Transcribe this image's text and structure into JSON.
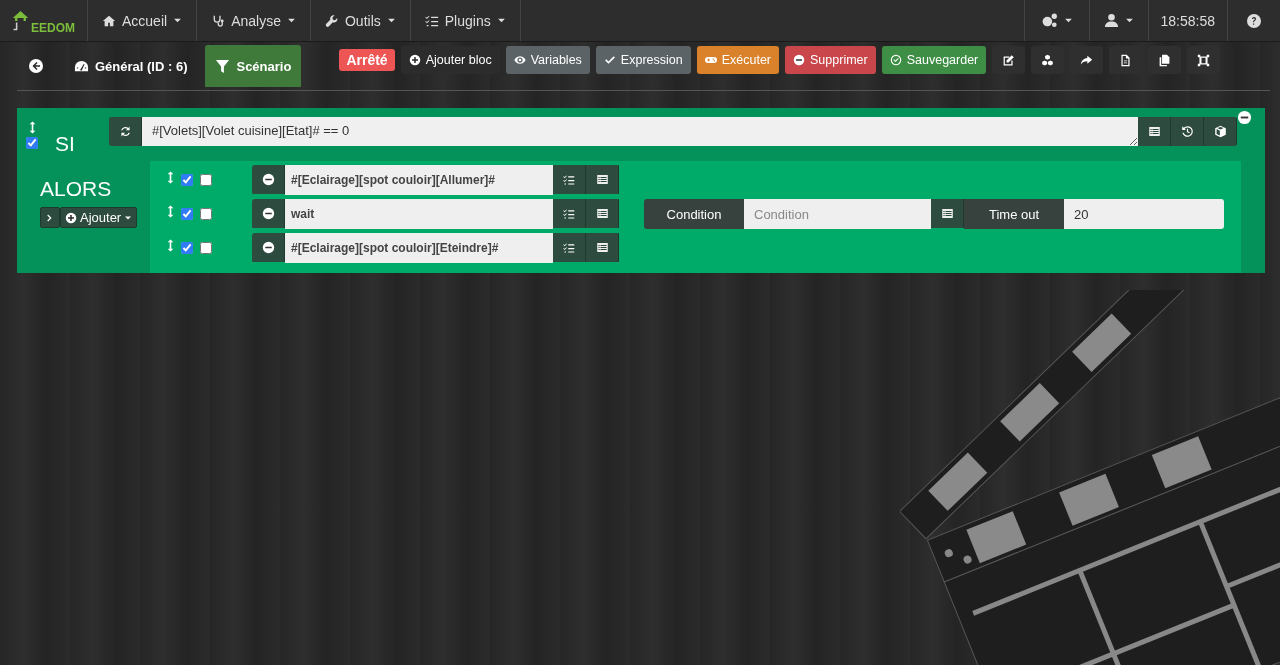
{
  "navbar": {
    "logo": "EEDOM",
    "menus": [
      {
        "label": "Accueil"
      },
      {
        "label": "Analyse"
      },
      {
        "label": "Outils"
      },
      {
        "label": "Plugins"
      }
    ],
    "clock": "18:58:58"
  },
  "tabs": [
    {
      "label": "Général (ID : 6)",
      "selected": false
    },
    {
      "label": "Scénario",
      "selected": true
    }
  ],
  "status_badge": "Arrêté",
  "actions": [
    {
      "label": "Ajouter bloc",
      "kind": "dark"
    },
    {
      "label": "Variables",
      "kind": "grey"
    },
    {
      "label": "Expression",
      "kind": "grey"
    },
    {
      "label": "Exécuter",
      "kind": "orange"
    },
    {
      "label": "Supprimer",
      "kind": "red"
    },
    {
      "label": "Sauvegarder",
      "kind": "green"
    }
  ],
  "block": {
    "enabled": true,
    "if_label": "SI",
    "condition": "#[Volets][Volet cuisine][Etat]# == 0",
    "then_label": "ALORS",
    "add_button": "Ajouter",
    "actions": [
      {
        "kind": "command",
        "enabled": true,
        "parallel": false,
        "value": "#[Eclairage][spot couloir][Allumer]#"
      },
      {
        "kind": "wait",
        "enabled": true,
        "parallel": false,
        "value": "wait",
        "condition_label": "Condition",
        "condition_placeholder": "Condition",
        "timeout_label": "Time out",
        "timeout_value": "20"
      },
      {
        "kind": "command",
        "enabled": true,
        "parallel": false,
        "value": "#[Eclairage][spot couloir][Eteindre]#"
      }
    ]
  }
}
